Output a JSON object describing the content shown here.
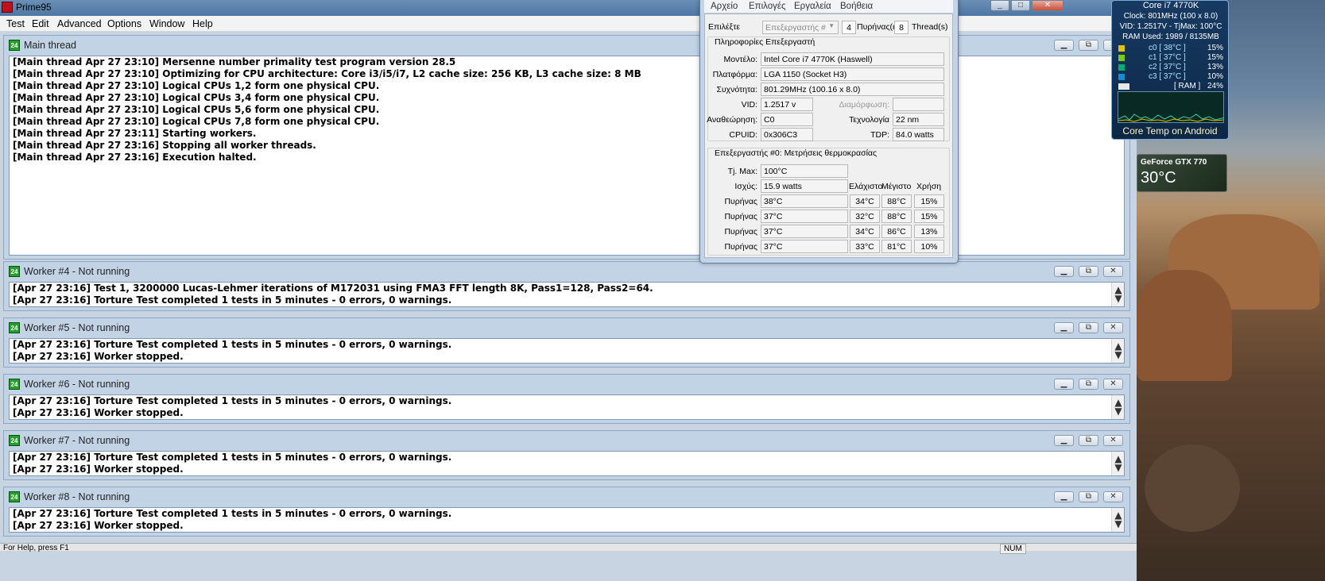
{
  "app": {
    "title": "Prime95"
  },
  "menu": [
    "Test",
    "Edit",
    "Advanced",
    "Options",
    "Window",
    "Help"
  ],
  "main_window": {
    "title": "Main thread",
    "lines": [
      "[Main thread Apr 27 23:10] Mersenne number primality test program version 28.5",
      "[Main thread Apr 27 23:10] Optimizing for CPU architecture: Core i3/i5/i7, L2 cache size: 256 KB, L3 cache size: 8 MB",
      "[Main thread Apr 27 23:10] Logical CPUs 1,2 form one physical CPU.",
      "[Main thread Apr 27 23:10] Logical CPUs 3,4 form one physical CPU.",
      "[Main thread Apr 27 23:10] Logical CPUs 5,6 form one physical CPU.",
      "[Main thread Apr 27 23:10] Logical CPUs 7,8 form one physical CPU.",
      "[Main thread Apr 27 23:11] Starting workers.",
      "[Main thread Apr 27 23:16] Stopping all worker threads.",
      "[Main thread Apr 27 23:16] Execution halted."
    ]
  },
  "workers": [
    {
      "title": "Worker #4 - Not running",
      "lines": [
        "[Apr 27 23:16] Test 1, 3200000 Lucas-Lehmer iterations of M172031 using FMA3 FFT length 8K, Pass1=128, Pass2=64.",
        "[Apr 27 23:16] Torture Test completed 1 tests in 5 minutes - 0 errors, 0 warnings."
      ]
    },
    {
      "title": "Worker #5 - Not running",
      "lines": [
        "[Apr 27 23:16] Torture Test completed 1 tests in 5 minutes - 0 errors, 0 warnings.",
        "[Apr 27 23:16] Worker stopped."
      ]
    },
    {
      "title": "Worker #6 - Not running",
      "lines": [
        "[Apr 27 23:16] Torture Test completed 1 tests in 5 minutes - 0 errors, 0 warnings.",
        "[Apr 27 23:16] Worker stopped."
      ]
    },
    {
      "title": "Worker #7 - Not running",
      "lines": [
        "[Apr 27 23:16] Torture Test completed 1 tests in 5 minutes - 0 errors, 0 warnings.",
        "[Apr 27 23:16] Worker stopped."
      ]
    },
    {
      "title": "Worker #8 - Not running",
      "lines": [
        "[Apr 27 23:16] Torture Test completed 1 tests in 5 minutes - 0 errors, 0 warnings.",
        "[Apr 27 23:16] Worker stopped."
      ]
    }
  ],
  "status": {
    "left": "For Help, press F1",
    "right": "NUM"
  },
  "coretemp": {
    "menu": [
      "Αρχείο",
      "Επιλογές",
      "Εργαλεία",
      "Βοήθεια"
    ],
    "select_label": "Επιλέξτε",
    "select_value": "Επεξεργαστής #",
    "cores_count": "4",
    "cores_label": "Πυρήνας(ε",
    "threads_count": "8",
    "threads_label": "Thread(s)",
    "info_title": "Πληροφορίες Επεξεργαστή",
    "model_label": "Μοντέλο:",
    "model": "Intel Core i7 4770K (Haswell)",
    "platform_label": "Πλατφόρμα:",
    "platform": "LGA 1150 (Socket H3)",
    "freq_label": "Συχνότητα:",
    "freq": "801.29MHz (100.16 x 8.0)",
    "vid_label": "VID:",
    "vid": "1.2517 v",
    "mod_label": "Διαμόρφωση:",
    "mod": "",
    "rev_label": "Αναθεώρηση:",
    "rev": "C0",
    "tech_label": "Τεχνολογία",
    "tech": "22 nm",
    "cpuid_label": "CPUID:",
    "cpuid": "0x306C3",
    "tdp_label": "TDP:",
    "tdp": "84.0 watts",
    "temps_title": "Επεξεργαστής #0: Μετρήσεις θερμοκρασίας",
    "tjmax_label": "Tj. Max:",
    "tjmax": "100°C",
    "power_label": "Ισχύς:",
    "power": "15.9 watts",
    "col_min": "Ελάχιστο",
    "col_max": "Μέγιστο",
    "col_use": "Χρήση",
    "cores": [
      {
        "label": "Πυρήνας",
        "temp": "38°C",
        "min": "34°C",
        "max": "88°C",
        "use": "15%"
      },
      {
        "label": "Πυρήνας",
        "temp": "37°C",
        "min": "32°C",
        "max": "88°C",
        "use": "15%"
      },
      {
        "label": "Πυρήνας",
        "temp": "37°C",
        "min": "34°C",
        "max": "86°C",
        "use": "13%"
      },
      {
        "label": "Πυρήνας",
        "temp": "37°C",
        "min": "33°C",
        "max": "81°C",
        "use": "10%"
      }
    ]
  },
  "gadget": {
    "line1": "Core i7 4770K",
    "line2": "Clock: 801MHz (100 x 8.0)",
    "line3": "VID: 1.2517V - TjMax: 100°C",
    "line4": "RAM Used: 1989 / 8135MB",
    "rows": [
      {
        "label": "c0 [ 38°C ]",
        "pct": "15%",
        "color": "#e0c000"
      },
      {
        "label": "c1 [ 37°C ]",
        "pct": "15%",
        "color": "#7acc00"
      },
      {
        "label": "c2 [ 37°C ]",
        "pct": "13%",
        "color": "#00b070"
      },
      {
        "label": "c3 [ 37°C ]",
        "pct": "10%",
        "color": "#1a8ad0"
      },
      {
        "label": "[ RAM ]",
        "pct": "24%",
        "color": "#e8e8e8"
      }
    ],
    "footer": "Core Temp on Android"
  },
  "gpu": {
    "name": "GeForce GTX 770",
    "temp": "30°C"
  }
}
